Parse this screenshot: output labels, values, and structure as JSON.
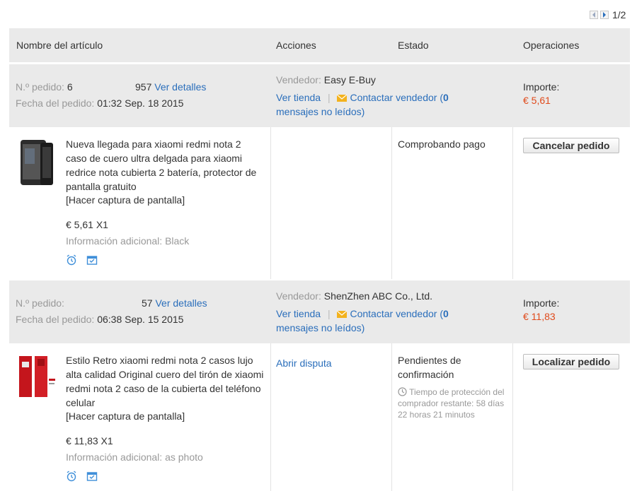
{
  "pager": {
    "prev_icon": "chevron-left-icon",
    "next_icon": "chevron-right-icon",
    "text": "1/2"
  },
  "header": {
    "name": "Nombre del artículo",
    "actions": "Acciones",
    "status": "Estado",
    "operations": "Operaciones"
  },
  "orders": [
    {
      "order_no_label": "N.º pedido:",
      "order_no_left": "6",
      "order_no_right": "957",
      "details_link": "Ver detalles",
      "date_label": "Fecha del pedido:",
      "date_value": "01:32 Sep. 18 2015",
      "seller_label": "Vendedor:",
      "seller_name": "Easy E-Buy",
      "store_link": "Ver tienda",
      "separator": "|",
      "contact_link": "Contactar vendedor (",
      "unread_count": "0",
      "unread_text": "mensajes no leídos)",
      "amount_label": "Importe:",
      "amount": "€ 5,61",
      "item": {
        "title": "Nueva llegada para xiaomi redmi nota 2 caso de cuero ultra delgada para xiaomi redrice nota cubierta 2 batería, protector de pantalla gratuito",
        "snapshot": "[Hacer captura de pantalla]",
        "price": "€ 5,61 X1",
        "extra_info": "Información adicional: Black",
        "status": "Comprobando pago",
        "action_button": "Cancelar pedido",
        "action_link": ""
      }
    },
    {
      "order_no_label": "N.º pedido:",
      "order_no_left": "",
      "order_no_right": "57",
      "details_link": "Ver detalles",
      "date_label": "Fecha del pedido:",
      "date_value": "06:38 Sep. 15 2015",
      "seller_label": "Vendedor:",
      "seller_name": "ShenZhen ABC Co., Ltd.",
      "store_link": "Ver tienda",
      "separator": "|",
      "contact_link": "Contactar vendedor (",
      "unread_count": "0",
      "unread_text": "mensajes no leídos)",
      "amount_label": "Importe:",
      "amount": "€ 11,83",
      "item": {
        "title": "Estilo Retro xiaomi redmi nota 2 casos lujo alta calidad Original cuero del tirón de xiaomi redmi nota 2 caso de la cubierta del teléfono celular",
        "snapshot": "[Hacer captura de pantalla]",
        "price": "€ 11,83 X1",
        "extra_info": "Información adicional: as photo",
        "status": "Pendientes de confirmación",
        "protection": "Tiempo de protección del comprador restante: 58 días 22 horas 21 minutos",
        "action_button": "Localizar pedido",
        "action_link": "Abrir disputa"
      }
    }
  ],
  "colors": {
    "link": "#2a6ebb",
    "price_red": "#e04a1b",
    "header_bg": "#eaeaea",
    "label_gray": "#999999"
  }
}
